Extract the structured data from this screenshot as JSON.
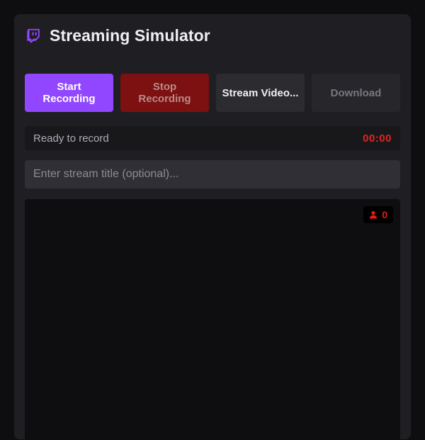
{
  "app": {
    "title": "Streaming Simulator",
    "logo_icon": "twitch-icon",
    "accent_color": "#9147ff"
  },
  "controls": {
    "start_label": "Start Recording",
    "stop_label": "Stop Recording",
    "stream_label": "Stream Video...",
    "download_label": "Download"
  },
  "status": {
    "text": "Ready to record",
    "timer": "00:00",
    "timer_color": "#e02424"
  },
  "stream_title": {
    "value": "",
    "placeholder": "Enter stream title (optional)..."
  },
  "viewers": {
    "icon": "user-icon",
    "count": "0",
    "color": "#e91916"
  }
}
